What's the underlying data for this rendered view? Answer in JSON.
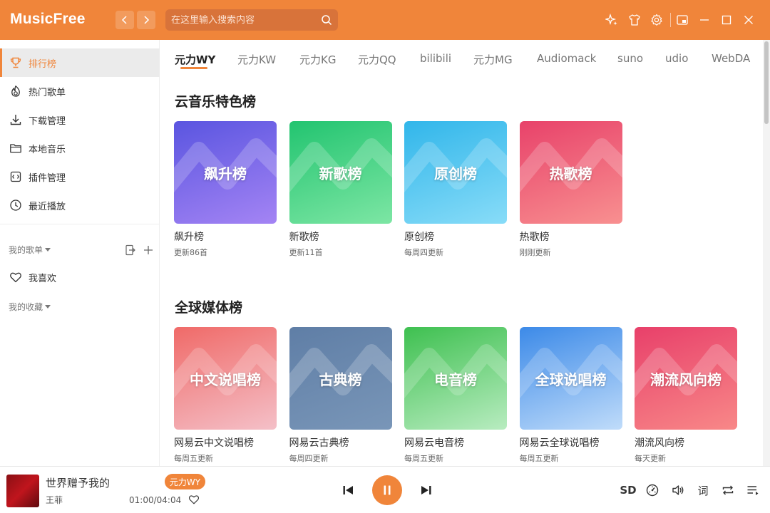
{
  "app": {
    "title": "MusicFree"
  },
  "header": {
    "search_placeholder": "在这里输入搜索内容"
  },
  "colors": {
    "accent": "#f0853a",
    "sidebar_active_bg": "#ebebeb"
  },
  "sidebar": {
    "items": [
      {
        "label": "排行榜",
        "icon": "trophy-icon",
        "active": true
      },
      {
        "label": "热门歌单",
        "icon": "fire-icon"
      },
      {
        "label": "下载管理",
        "icon": "download-icon"
      },
      {
        "label": "本地音乐",
        "icon": "folder-icon"
      },
      {
        "label": "插件管理",
        "icon": "plugin-icon"
      },
      {
        "label": "最近播放",
        "icon": "clock-icon"
      }
    ],
    "my_playlists_label": "我的歌单",
    "favorite_label": "我喜欢",
    "my_collections_label": "我的收藏"
  },
  "tabs": [
    "元力WY",
    "元力KW",
    "元力KG",
    "元力QQ",
    "bilibili",
    "元力MG",
    "Audiomack",
    "suno",
    "udio",
    "WebDA"
  ],
  "sections": [
    {
      "title": "云音乐特色榜",
      "cards": [
        {
          "cover_text": "飙升榜",
          "name": "飙升榜",
          "desc": "更新86首",
          "color_a": "#5a55e0",
          "color_b": "#a484f4"
        },
        {
          "cover_text": "新歌榜",
          "name": "新歌榜",
          "desc": "更新11首",
          "color_a": "#22c470",
          "color_b": "#7de6a4"
        },
        {
          "cover_text": "原创榜",
          "name": "原创榜",
          "desc": "每周四更新",
          "color_a": "#31b6ea",
          "color_b": "#88dcf8"
        },
        {
          "cover_text": "热歌榜",
          "name": "热歌榜",
          "desc": "刚刚更新",
          "color_a": "#e8426a",
          "color_b": "#f89090"
        }
      ]
    },
    {
      "title": "全球媒体榜",
      "cards": [
        {
          "cover_text": "中文说唱榜",
          "name": "网易云中文说唱榜",
          "desc": "每周五更新",
          "color_a": "#f06a68",
          "color_b": "#f4c0c8"
        },
        {
          "cover_text": "古典榜",
          "name": "网易云古典榜",
          "desc": "每周四更新",
          "color_a": "#5f7ea6",
          "color_b": "#7996b8"
        },
        {
          "cover_text": "电音榜",
          "name": "网易云电音榜",
          "desc": "每周五更新",
          "color_a": "#3ec050",
          "color_b": "#b8ecc0"
        },
        {
          "cover_text": "全球说唱榜",
          "name": "网易云全球说唱榜",
          "desc": "每周五更新",
          "color_a": "#3c8ae8",
          "color_b": "#c0dcfa"
        },
        {
          "cover_text": "潮流风向榜",
          "name": "潮流风向榜",
          "desc": "每天更新",
          "color_a": "#e8406a",
          "color_b": "#f88888"
        }
      ]
    }
  ],
  "player": {
    "song_title": "世界赠予我的",
    "artist": "王菲",
    "source_badge": "元力WY",
    "time": "01:00/04:04",
    "quality": "SD",
    "lyrics_label": "词"
  }
}
